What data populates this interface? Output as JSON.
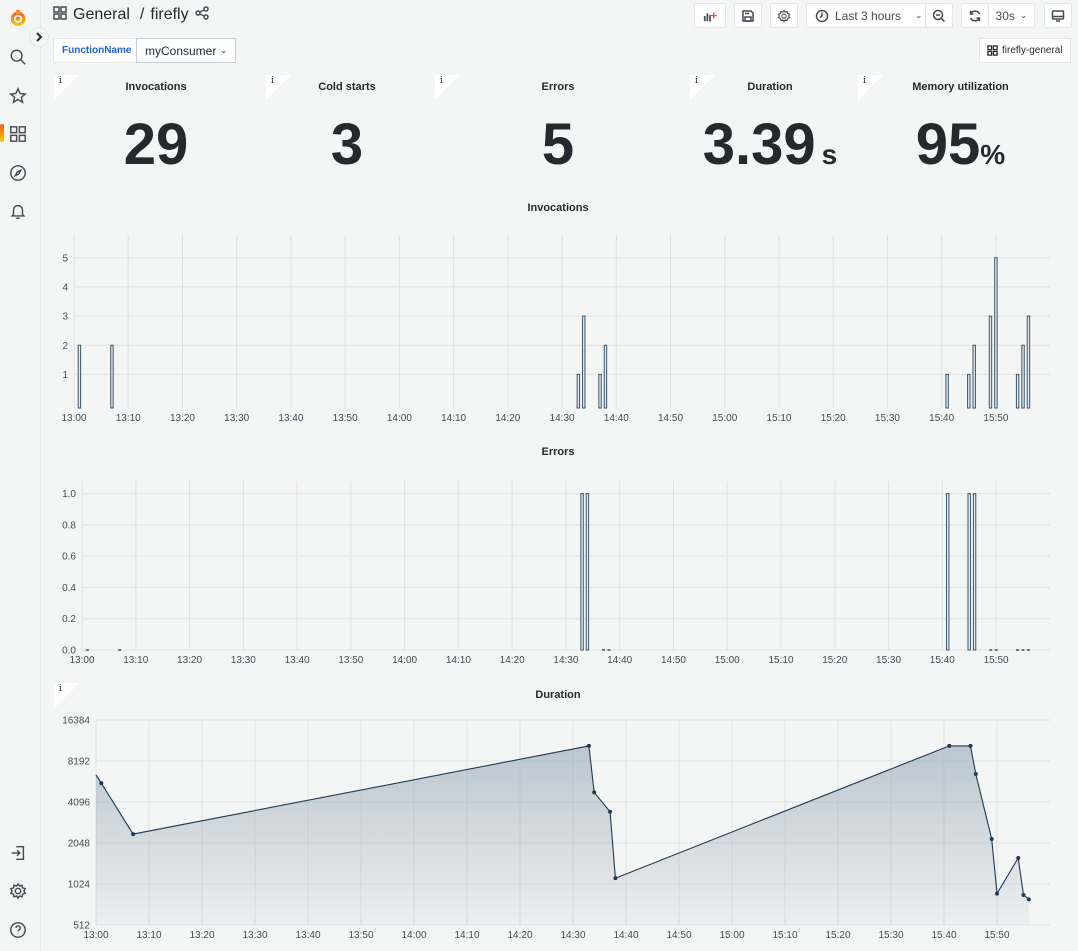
{
  "sidebar": {
    "items": [
      {
        "name": "grafana-logo",
        "icon": "grafana-logo"
      },
      {
        "name": "search",
        "icon": "search-icon"
      },
      {
        "name": "starred",
        "icon": "star-icon"
      },
      {
        "name": "dashboards",
        "icon": "dashboards-grid-icon",
        "active": true
      },
      {
        "name": "explore",
        "icon": "compass-icon"
      },
      {
        "name": "alerting",
        "icon": "bell-icon"
      },
      {
        "name": "sign-in",
        "icon": "sign-in-icon"
      },
      {
        "name": "configuration",
        "icon": "gear-icon"
      },
      {
        "name": "help",
        "icon": "help-icon"
      }
    ],
    "accent": "#f05a28"
  },
  "header": {
    "folder": "General",
    "separator": "/",
    "dashboard": "firefly"
  },
  "toolbar": {
    "add_panel": "add-panel-icon",
    "save": "save-icon",
    "settings": "gear-icon",
    "time_range": "Last 3 hours",
    "zoom_out": "zoom-out-icon",
    "refresh": "refresh-icon",
    "refresh_interval": "30s",
    "tv_mode": "monitor-icon"
  },
  "variables": {
    "label": "FunctionName",
    "value": "myConsumer",
    "label_color": "#1f62e0"
  },
  "dashboard_link": "firefly-general",
  "stats": [
    {
      "title": "Invocations",
      "value": "29",
      "unit": ""
    },
    {
      "title": "Cold starts",
      "value": "3",
      "unit": ""
    },
    {
      "title": "Errors",
      "value": "5",
      "unit": ""
    },
    {
      "title": "Duration",
      "value": "3.39",
      "unit": "s"
    },
    {
      "title": "Memory utilization",
      "value": "95",
      "unit": "%"
    }
  ],
  "info_glyph": "i",
  "chart_data": [
    {
      "type": "bar",
      "title": "Invocations",
      "x_ticks": [
        "13:00",
        "13:10",
        "13:20",
        "13:30",
        "13:40",
        "13:50",
        "14:00",
        "14:10",
        "14:20",
        "14:30",
        "14:40",
        "14:50",
        "15:00",
        "15:10",
        "15:20",
        "15:30",
        "15:40",
        "15:50"
      ],
      "y_ticks": [
        "1",
        "2",
        "3",
        "4",
        "5"
      ],
      "ylim": [
        0.5,
        5.3
      ],
      "x": [
        "13:01",
        "13:07",
        "14:33",
        "14:34",
        "14:37",
        "14:38",
        "15:41",
        "15:45",
        "15:46",
        "15:49",
        "15:50",
        "15:54",
        "15:55",
        "15:56"
      ],
      "values": [
        2,
        2,
        1,
        3,
        1,
        2,
        1,
        1,
        2,
        3,
        5,
        1,
        2,
        3
      ],
      "color": "#37536b",
      "grid": true
    },
    {
      "type": "bar",
      "title": "Errors",
      "x_ticks": [
        "13:00",
        "13:10",
        "13:20",
        "13:30",
        "13:40",
        "13:50",
        "14:00",
        "14:10",
        "14:20",
        "14:30",
        "14:40",
        "14:50",
        "15:00",
        "15:10",
        "15:20",
        "15:30",
        "15:40",
        "15:50"
      ],
      "y_ticks": [
        "0.0",
        "0.2",
        "0.4",
        "0.6",
        "0.8",
        "1.0"
      ],
      "ylim": [
        0,
        1.1
      ],
      "x": [
        "13:01",
        "13:07",
        "14:33",
        "14:34",
        "14:37",
        "14:38",
        "15:41",
        "15:45",
        "15:46",
        "15:49",
        "15:50",
        "15:54",
        "15:55",
        "15:56"
      ],
      "values": [
        0,
        0,
        1,
        1,
        0,
        0,
        1,
        1,
        1,
        0,
        0,
        0,
        0,
        0
      ],
      "color": "#37536b",
      "grid": true
    },
    {
      "type": "area",
      "title": "Duration",
      "y_scale": "log2",
      "x_ticks": [
        "13:00",
        "13:10",
        "13:20",
        "13:30",
        "13:40",
        "13:50",
        "14:00",
        "14:10",
        "14:20",
        "14:30",
        "14:40",
        "14:50",
        "15:00",
        "15:10",
        "15:20",
        "15:30",
        "15:40",
        "15:50"
      ],
      "y_ticks": [
        "512",
        "1024",
        "2048",
        "4096",
        "8192",
        "16384"
      ],
      "ylim": [
        512,
        16384
      ],
      "x": [
        "13:00",
        "13:01",
        "13:07",
        "14:33",
        "14:34",
        "14:37",
        "14:38",
        "15:41",
        "15:45",
        "15:46",
        "15:49",
        "15:50",
        "15:54",
        "15:55",
        "15:56"
      ],
      "values": [
        6480,
        5630,
        2380,
        10570,
        4820,
        3470,
        1130,
        10570,
        10570,
        6580,
        2190,
        870,
        1590,
        850,
        790
      ],
      "color": "#1f3a52",
      "grid": true
    }
  ]
}
